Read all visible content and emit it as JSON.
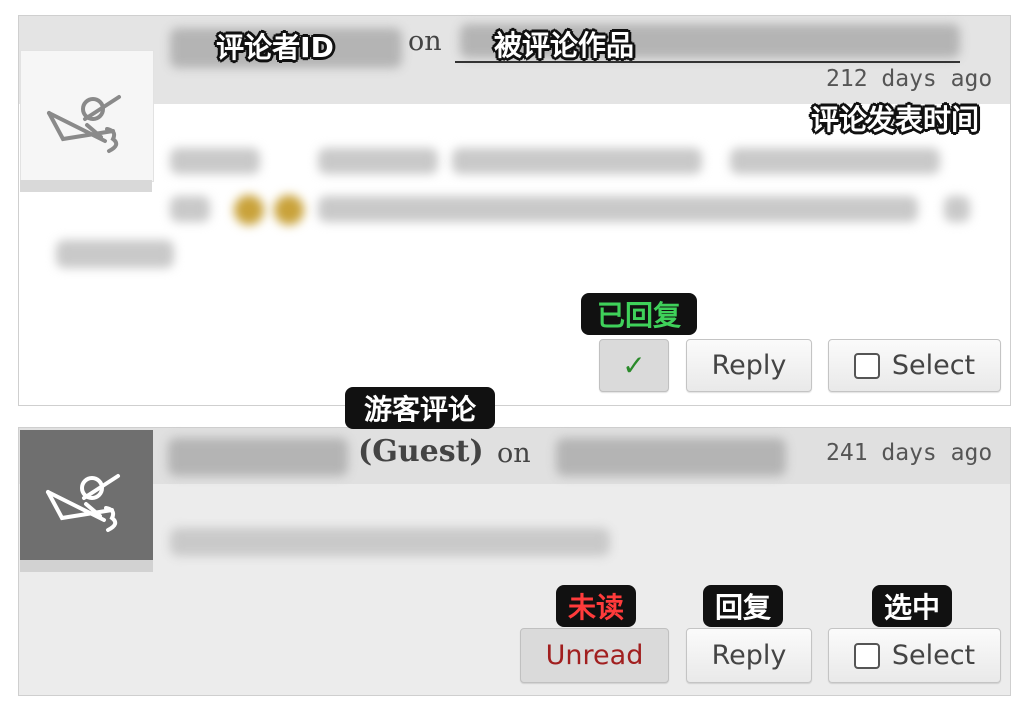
{
  "comment1": {
    "on_label": "on",
    "time": "212 days ago",
    "buttons": {
      "replied_icon": "✓",
      "reply": "Reply",
      "select": "Select"
    }
  },
  "comment2": {
    "guest_label": "(Guest)",
    "on_label": "on",
    "time": "241 days ago",
    "buttons": {
      "unread": "Unread",
      "reply": "Reply",
      "select": "Select"
    }
  },
  "annotations": {
    "commenter_id": "评论者ID",
    "commented_work": "被评论作品",
    "comment_time": "评论发表时间",
    "replied": "已回复",
    "guest_comment": "游客评论",
    "unread": "未读",
    "reply": "回复",
    "select": "选中"
  },
  "colors": {
    "replied_check": "#2a8a2a",
    "unread_text": "#a11f1f"
  }
}
